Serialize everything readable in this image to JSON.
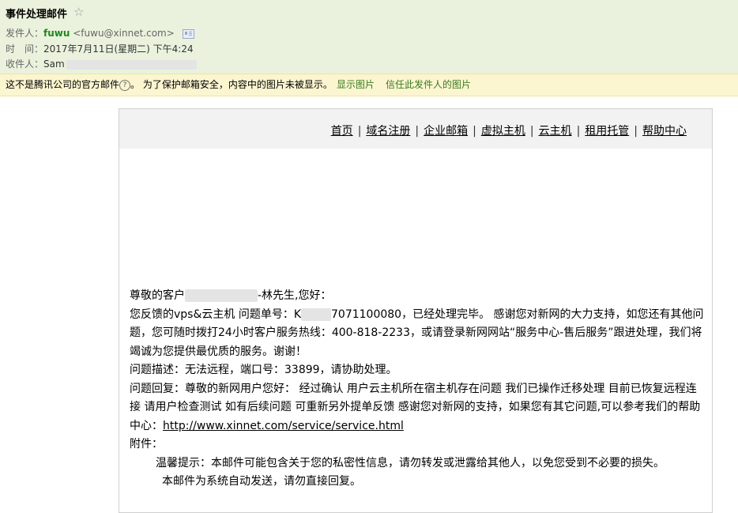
{
  "header": {
    "subject": "事件处理邮件",
    "star_icon": "star-outline-icon",
    "from_label": "发件人：",
    "from_name": "fuwu",
    "from_addr": "<fuwu@xinnet.com>",
    "contact_card_icon": "contact-card-icon",
    "time_label": "时　间：",
    "time_value": "2017年7月11日(星期二) 下午4:24",
    "to_label": "收件人：",
    "to_value": "Sam"
  },
  "warning": {
    "text_before": "这不是腾讯公司的官方邮件",
    "help_icon": "question-icon",
    "text_after": "。 为了保护邮箱安全，内容中的图片未被显示。",
    "show_images": "显示图片",
    "trust_sender": "信任此发件人的图片"
  },
  "nav": {
    "items": [
      "首页",
      "域名注册",
      "企业邮箱",
      "虚拟主机",
      "云主机",
      "租用托管",
      "帮助中心"
    ]
  },
  "body": {
    "greeting_prefix": "尊敬的客户",
    "greeting_suffix": "-林先生,您好：",
    "line2_prefix": "您反馈的vps&云主机 问题单号：K",
    "line2_suffix": "7071100080，已经处理完毕。 感谢您对新网的大力支持，如您还有其他问题，您可随时拨打24小时客户服务热线：400-818-2233，或请登录新网网站“服务中心-售后服务”跟进处理，我们将竭诚为您提供最优质的服务。谢谢！",
    "problem": "问题描述：无法远程，端口号：33899，请协助处理。",
    "reply": "问题回复：尊敬的新网用户您好： 经过确认 用户云主机所在宿主机存在问题 我们已操作迁移处理 目前已恢复远程连接 请用户检查测试 如有后续问题 可重新另外提单反馈 感谢您对新网的支持，如果您有其它问题,可以参考我们的帮助中心：",
    "help_link": "http://www.xinnet.com/service/service.html",
    "attachment": "附件：",
    "tip": "温馨提示：本邮件可能包含关于您的私密性信息，请勿转发或泄露给其他人，以免您受到不必要的损失。",
    "auto": "本邮件为系统自动发送，请勿直接回复。"
  }
}
